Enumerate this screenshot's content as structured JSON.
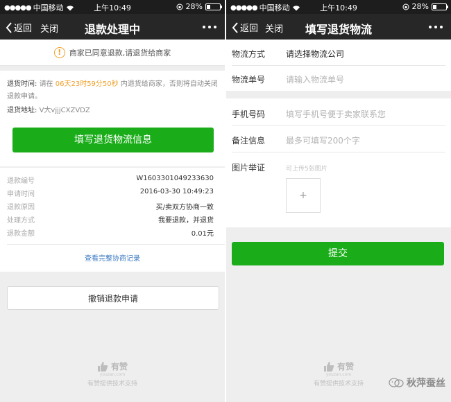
{
  "statusbar": {
    "carrier": "中国移动",
    "time": "上午10:49",
    "battery": "28%",
    "battery_level": 0.28
  },
  "left": {
    "nav": {
      "back": "返回",
      "close": "关闭",
      "title": "退款处理中"
    },
    "notice": "商家已同意退款,请退货给商家",
    "return_info": {
      "time_label": "退货时间:",
      "time_prefix": "请在",
      "countdown": "06天23时59分50秒",
      "time_suffix": "内退货给商家，否则将自动关闭退款申请。",
      "address_label": "退货地址:",
      "address_value": "V大vjjjCXZVDZ"
    },
    "fill_button": "填写退货物流信息",
    "details": [
      {
        "key": "退款编号",
        "value": "W1603301049233630"
      },
      {
        "key": "申请时间",
        "value": "2016-03-30 10:49:23"
      },
      {
        "key": "退款原因",
        "value": "买/卖双方协商一致"
      },
      {
        "key": "处理方式",
        "value": "我要退款，并退货"
      },
      {
        "key": "退款金额",
        "value": "0.01元"
      }
    ],
    "history_link": "查看完整协商记录",
    "cancel_button": "撤销退款申请"
  },
  "right": {
    "nav": {
      "back": "返回",
      "close": "关闭",
      "title": "填写退货物流"
    },
    "logistics_method": {
      "label": "物流方式",
      "value": "请选择物流公司"
    },
    "tracking_number": {
      "label": "物流单号",
      "placeholder": "请输入物流单号"
    },
    "phone": {
      "label": "手机号码",
      "placeholder": "填写手机号便于卖家联系您"
    },
    "remark": {
      "label": "备注信息",
      "placeholder": "最多可填写200个字"
    },
    "photo": {
      "label": "图片举证",
      "hint": "可上传5张图片",
      "add": "+"
    },
    "submit_button": "提交"
  },
  "footer": {
    "brand": "有赞",
    "domain": "youzan.com",
    "text": "有赞提供技术支持"
  },
  "watermark": "秋萍蚕丝",
  "colors": {
    "primary_green": "#1aad19",
    "highlight_orange": "#f0a02a",
    "link_blue": "#3a78c2",
    "navbar": "#272727"
  }
}
